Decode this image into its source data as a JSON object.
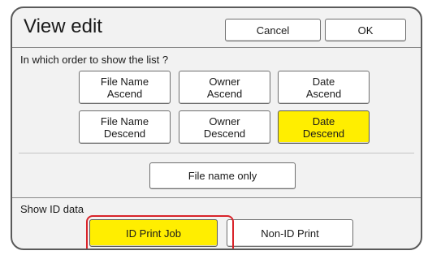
{
  "dialog": {
    "title": "View edit",
    "cancel_label": "Cancel",
    "ok_label": "OK"
  },
  "sort": {
    "heading": "In which order to show the list ?",
    "options": [
      {
        "label": "File Name\nAscend",
        "selected": false
      },
      {
        "label": "Owner\nAscend",
        "selected": false
      },
      {
        "label": "Date\nAscend",
        "selected": false
      },
      {
        "label": "File Name\nDescend",
        "selected": false
      },
      {
        "label": "Owner\nDescend",
        "selected": false
      },
      {
        "label": "Date\nDescend",
        "selected": true
      }
    ],
    "filename_only_label": "File name only"
  },
  "id_data": {
    "heading": "Show ID data",
    "options": [
      {
        "label": "ID Print Job",
        "selected": true
      },
      {
        "label": "Non-ID Print",
        "selected": false
      }
    ]
  },
  "colors": {
    "selected": "#ffee00",
    "highlight": "#d9232a"
  }
}
